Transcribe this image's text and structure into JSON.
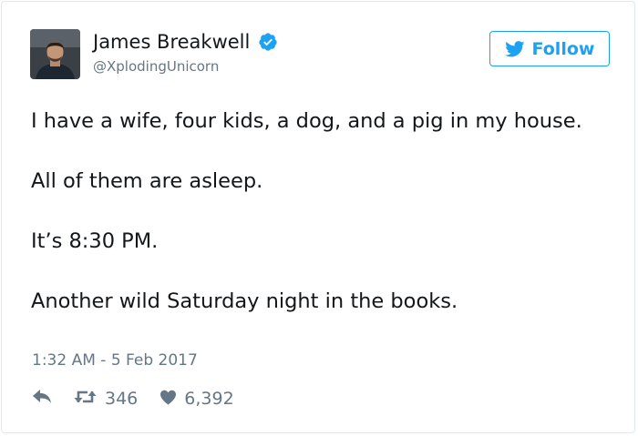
{
  "author": {
    "display_name": "James Breakwell",
    "handle": "@XplodingUnicorn",
    "verified": true,
    "verified_icon": "verified-badge-icon",
    "avatar_icon": "profile-photo"
  },
  "follow_button": {
    "label": "Follow",
    "icon": "twitter-bird-icon"
  },
  "tweet": {
    "paragraphs": [
      "I have a wife, four kids, a dog, and a pig in my house.",
      "All of them are asleep.",
      "It’s 8:30 PM.",
      "Another wild Saturday night in the books."
    ],
    "timestamp": "1:32 AM - 5 Feb 2017"
  },
  "actions": {
    "reply_icon": "reply-arrow-icon",
    "retweet_icon": "retweet-icon",
    "retweet_count": "346",
    "like_icon": "heart-icon",
    "like_count": "6,392"
  },
  "colors": {
    "accent": "#1da1f2",
    "text": "#14171a",
    "muted": "#657786",
    "border": "#e1e8ed"
  }
}
